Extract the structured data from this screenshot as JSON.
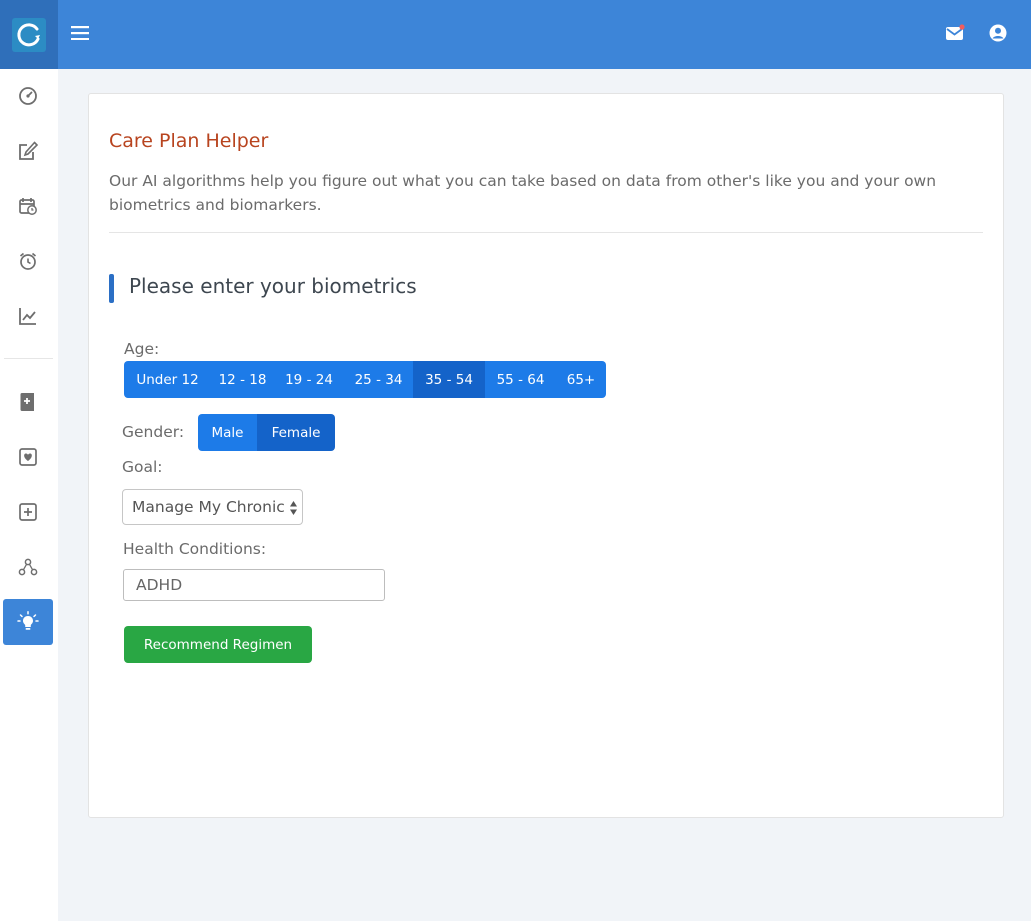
{
  "colors": {
    "header": "#3d85d8",
    "accent_title": "#b8441f",
    "button_blue": "#1d7be8",
    "button_selected": "#1463c9",
    "button_green": "#29a744"
  },
  "header": {
    "icons": [
      "menu-icon",
      "mail-icon",
      "user-circle-icon"
    ]
  },
  "sidebar": {
    "items": [
      {
        "icon": "dashboard-gauge-icon",
        "active": false
      },
      {
        "icon": "edit-note-icon",
        "active": false
      },
      {
        "icon": "calendar-clock-icon",
        "active": false
      },
      {
        "icon": "alarm-clock-icon",
        "active": false
      },
      {
        "icon": "line-chart-icon",
        "active": false
      },
      {
        "icon": "book-add-icon",
        "active": false
      },
      {
        "icon": "heart-card-icon",
        "active": false
      },
      {
        "icon": "plus-square-icon",
        "active": false
      },
      {
        "icon": "molecule-icon",
        "active": false
      },
      {
        "icon": "lightbulb-icon",
        "active": true
      }
    ]
  },
  "card": {
    "title": "Care Plan Helper",
    "description": "Our AI algorithms help you figure out what you can take based on data from other's like you and your own biometrics and biomarkers.",
    "section_title": "Please enter your biometrics"
  },
  "form": {
    "age": {
      "label": "Age:",
      "options": [
        "Under 12",
        "12 - 18",
        "19 - 24",
        "25 - 34",
        "35 - 54",
        "55 - 64",
        "65+"
      ],
      "selected": "35 - 54"
    },
    "gender": {
      "label": "Gender:",
      "options": [
        "Male",
        "Female"
      ],
      "selected": "Female"
    },
    "goal": {
      "label": "Goal:",
      "value": "Manage My Chronic"
    },
    "health_conditions": {
      "label": "Health Conditions:",
      "value": "ADHD"
    },
    "submit_label": "Recommend Regimen"
  }
}
